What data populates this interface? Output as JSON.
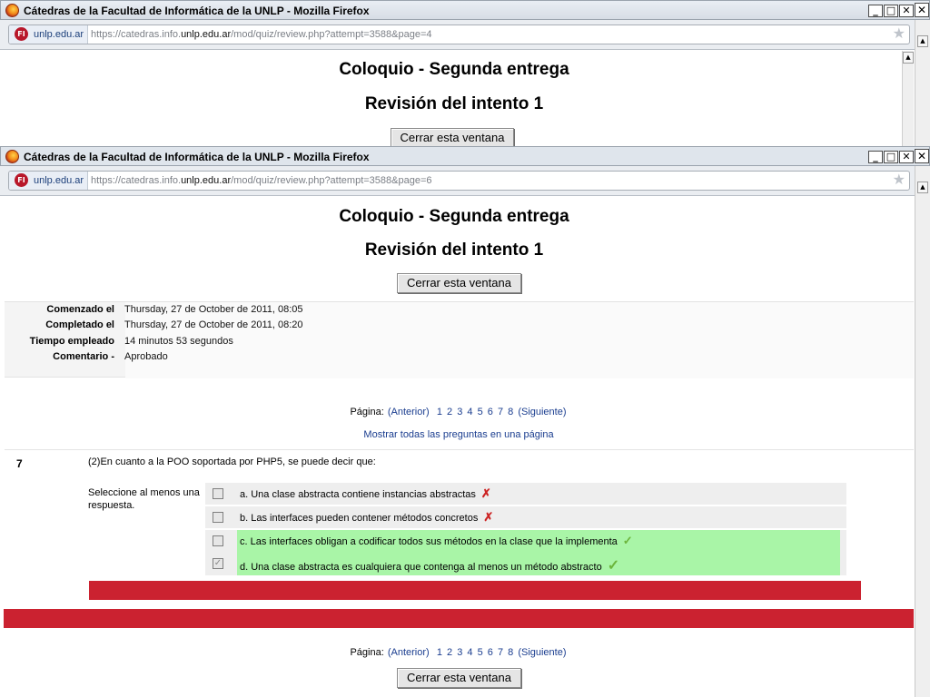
{
  "back_window": {
    "title": "Cátedras de la Facultad de Informática de la UNLP - Mozilla Firefox",
    "site_badge": "unlp.edu.ar",
    "url_prefix": "https://catedras.info.",
    "url_host": "unlp.edu.ar",
    "url_path": "/mod/quiz/review.php?attempt=3588&page=4",
    "heading": "Coloquio - Segunda entrega",
    "subheading": "Revisión del intento 1",
    "close_button": "Cerrar esta ventana"
  },
  "front_window": {
    "title": "Cátedras de la Facultad de Informática de la UNLP - Mozilla Firefox",
    "site_badge": "unlp.edu.ar",
    "url_prefix": "https://catedras.info.",
    "url_host": "unlp.edu.ar",
    "url_path": "/mod/quiz/review.php?attempt=3588&page=6",
    "heading": "Coloquio - Segunda entrega",
    "subheading": "Revisión del intento 1",
    "close_button": "Cerrar esta ventana",
    "info": [
      {
        "label": "Comenzado el",
        "value": "Thursday, 27 de October de 2011, 08:05"
      },
      {
        "label": "Completado el",
        "value": "Thursday, 27 de October de 2011, 08:20"
      },
      {
        "label": "Tiempo empleado",
        "value": "14 minutos 53 segundos"
      },
      {
        "label": "Comentario -",
        "value": "Aprobado"
      }
    ],
    "pagination": {
      "label": "Página:",
      "prev": "(Anterior)",
      "pages": [
        "1",
        "2",
        "3",
        "4",
        "5",
        "6",
        "7",
        "8"
      ],
      "next": "(Siguiente)"
    },
    "show_all": "Mostrar todas las preguntas en una página",
    "question": {
      "number": "7",
      "text": "(2)En cuanto a la POO soportada por PHP5, se puede decir que:",
      "prompt": "Seleccione al menos una respuesta.",
      "options": [
        {
          "label": "a. Una clase abstracta contiene instancias abstractas",
          "selected": false,
          "correct": false,
          "mark": "✗"
        },
        {
          "label": "b. Las interfaces pueden contener métodos concretos",
          "selected": false,
          "correct": false,
          "mark": "✗"
        },
        {
          "label": "c. Las interfaces obligan a codificar todos sus métodos en la clase que la implementa",
          "selected": false,
          "correct": true,
          "mark": "✓"
        },
        {
          "label": "d. Una clase abstracta es cualquiera que contenga al menos un método abstracto",
          "selected": true,
          "correct": true,
          "mark": "✓"
        }
      ]
    },
    "feedback_color": "#cb2230"
  },
  "icons": {
    "minimize": "_",
    "maximize": "□",
    "close": "✕",
    "bookmark_star": "★",
    "checkbox_checked": "✓",
    "scroll_up": "▲",
    "scroll_down": "▼",
    "site_logo": "FI"
  }
}
